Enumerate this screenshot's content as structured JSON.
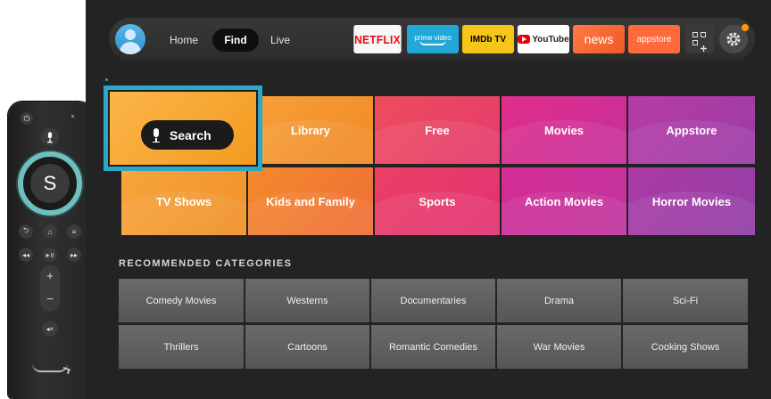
{
  "nav": {
    "tabs": [
      {
        "label": "Home",
        "active": false
      },
      {
        "label": "Find",
        "active": true
      },
      {
        "label": "Live",
        "active": false
      }
    ],
    "apps": [
      {
        "label": "NETFLIX",
        "icon": "netflix-logo"
      },
      {
        "label": "prime video",
        "icon": "prime-video-logo"
      },
      {
        "label": "IMDb TV",
        "icon": "imdb-tv-logo"
      },
      {
        "label": "YouTube",
        "icon": "youtube-logo"
      },
      {
        "label": "news",
        "icon": "news-logo"
      },
      {
        "label": "appstore",
        "icon": "appstore-logo"
      }
    ],
    "apps_grid_icon": "apps-grid-icon",
    "settings_icon": "gear-icon"
  },
  "find": {
    "search_label": "Search",
    "tiles": [
      "Library",
      "Free",
      "Movies",
      "Appstore",
      "TV Shows",
      "Kids and Family",
      "Sports",
      "Action Movies",
      "Horror Movies"
    ]
  },
  "recommended": {
    "header": "RECOMMENDED CATEGORIES",
    "items": [
      "Comedy Movies",
      "Westerns",
      "Documentaries",
      "Drama",
      "Sci-Fi",
      "Thrillers",
      "Cartoons",
      "Romantic Comedies",
      "War Movies",
      "Cooking Shows"
    ]
  },
  "remote": {
    "center_button": "S",
    "volume_up": "+",
    "volume_down": "−",
    "mute": "◂×"
  },
  "colors": {
    "focus_border": "#2aa7c9",
    "background": "#232323",
    "orange": "#f58f20",
    "magenta": "#e5277f",
    "purple": "#9b3fa7"
  }
}
